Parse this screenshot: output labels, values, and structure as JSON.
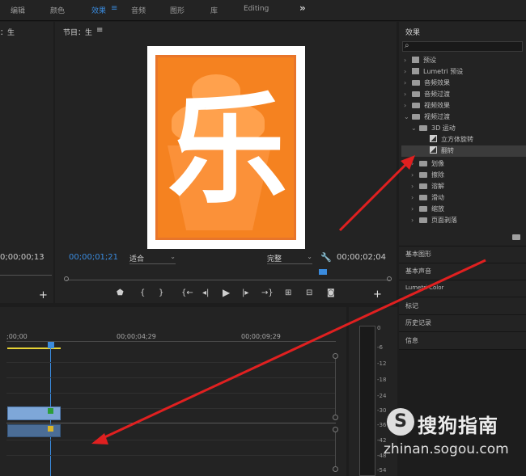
{
  "topbar": {
    "tabs": [
      {
        "label": "编辑",
        "active": false
      },
      {
        "label": "颜色",
        "active": false
      },
      {
        "label": "效果",
        "active": true
      },
      {
        "label": "音频",
        "active": false
      },
      {
        "label": "图形",
        "active": false
      },
      {
        "label": "库",
        "active": false
      },
      {
        "label": "Editing",
        "active": false
      }
    ],
    "more_glyph": "»",
    "menu_glyph": "≡"
  },
  "source_panel": {
    "title": "：生",
    "timecode": "0;00;00;13"
  },
  "program": {
    "title": "节目：生",
    "menu_glyph": "≡",
    "frame_char": "乐",
    "timecode_current": "00;00;01;21",
    "fit_label": "适合",
    "quality_label": "完整",
    "timecode_duration": "00;00;02;04"
  },
  "effects": {
    "title": "效果",
    "search_glyph": "⌕",
    "items": [
      {
        "label": "预设",
        "kind": "preset",
        "depth": 0,
        "chevron": "›",
        "selected": false
      },
      {
        "label": "Lumetri 预设",
        "kind": "preset",
        "depth": 0,
        "chevron": "›",
        "selected": false
      },
      {
        "label": "音频效果",
        "kind": "folder",
        "depth": 0,
        "chevron": "›",
        "selected": false
      },
      {
        "label": "音频过渡",
        "kind": "folder",
        "depth": 0,
        "chevron": "›",
        "selected": false
      },
      {
        "label": "视频效果",
        "kind": "folder",
        "depth": 0,
        "chevron": "›",
        "selected": false
      },
      {
        "label": "视频过渡",
        "kind": "folder",
        "depth": 0,
        "chevron": "⌄",
        "selected": false
      },
      {
        "label": "3D 运动",
        "kind": "folder",
        "depth": 1,
        "chevron": "⌄",
        "selected": false
      },
      {
        "label": "立方体旋转",
        "kind": "transition",
        "depth": 2,
        "chevron": "",
        "selected": false
      },
      {
        "label": "翻转",
        "kind": "transition",
        "depth": 2,
        "chevron": "",
        "selected": true
      },
      {
        "label": "划像",
        "kind": "folder",
        "depth": 1,
        "chevron": "›",
        "selected": false
      },
      {
        "label": "擦除",
        "kind": "folder",
        "depth": 1,
        "chevron": "›",
        "selected": false
      },
      {
        "label": "溶解",
        "kind": "folder",
        "depth": 1,
        "chevron": "›",
        "selected": false
      },
      {
        "label": "滑动",
        "kind": "folder",
        "depth": 1,
        "chevron": "›",
        "selected": false
      },
      {
        "label": "缩放",
        "kind": "folder",
        "depth": 1,
        "chevron": "›",
        "selected": false
      },
      {
        "label": "页面剥落",
        "kind": "folder",
        "depth": 1,
        "chevron": "›",
        "selected": false
      }
    ]
  },
  "side_panels": [
    "基本图形",
    "基本声音",
    "Lumetri Color",
    "标记",
    "历史记录",
    "信息"
  ],
  "timeline": {
    "ruler": [
      ";00;00",
      "00;00;04;29",
      "00;00;09;29"
    ]
  },
  "meter": {
    "scale": [
      "0",
      "-6",
      "-12",
      "-18",
      "-24",
      "-30",
      "-36",
      "-42",
      "-48",
      "-54"
    ]
  },
  "watermark": {
    "logo_letter": "S",
    "brand": "搜狗指南",
    "url": "zhinan.sogou.com"
  },
  "colors": {
    "accent": "#3a8bde",
    "frame_orange": "#f58220",
    "arrow_red": "#e02020",
    "clip_blue": "#7ea7d8"
  }
}
